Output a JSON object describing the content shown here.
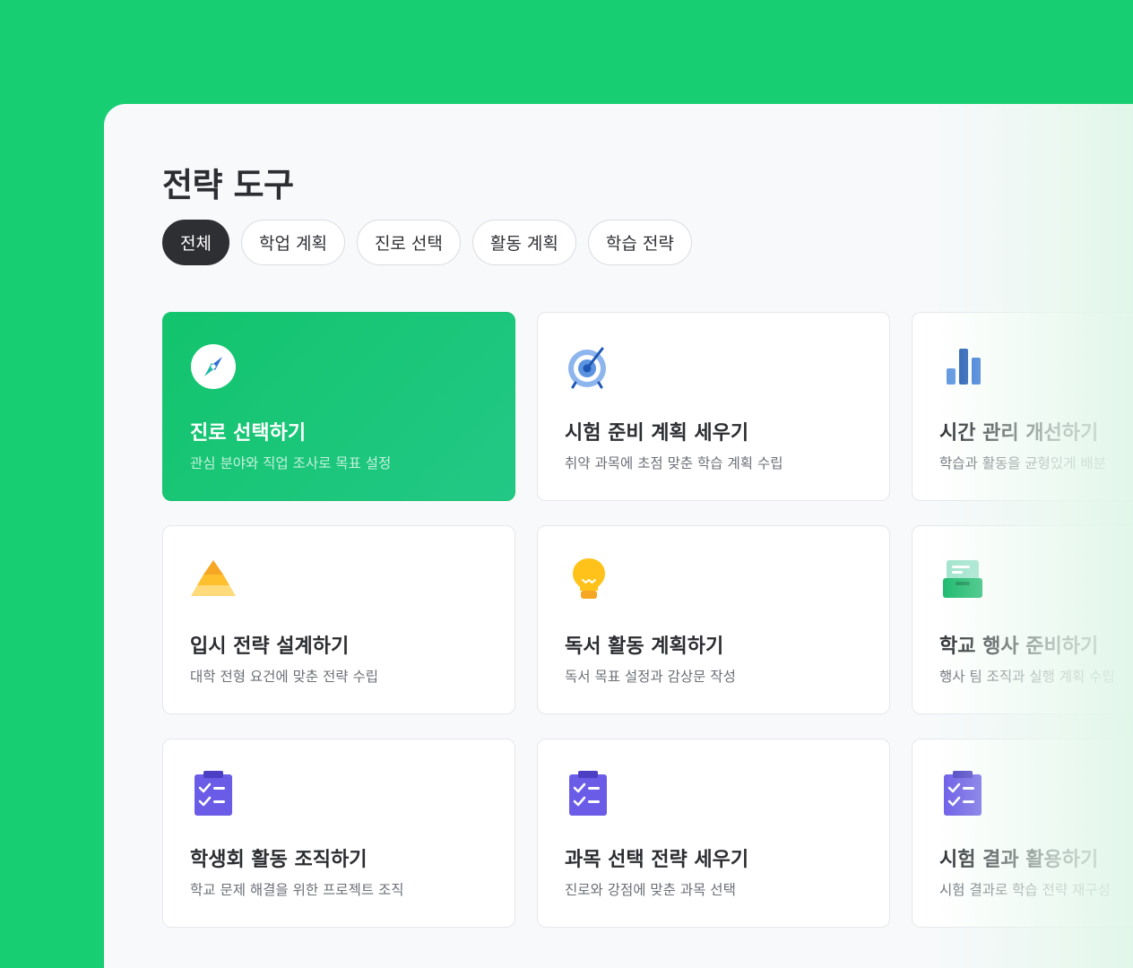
{
  "page": {
    "title": "전략 도구"
  },
  "filters": [
    {
      "label": "전체",
      "active": true
    },
    {
      "label": "학업 계획",
      "active": false
    },
    {
      "label": "진로 선택",
      "active": false
    },
    {
      "label": "활동 계획",
      "active": false
    },
    {
      "label": "학습 전략",
      "active": false
    }
  ],
  "cards": [
    {
      "title": "진로 선택하기",
      "description": "관심 분야와 직업 조사로 목표 설정",
      "icon": "compass-icon",
      "active": true
    },
    {
      "title": "시험 준비 계획 세우기",
      "description": "취약 과목에 초점 맞춘 학습 계획 수립",
      "icon": "target-icon",
      "active": false
    },
    {
      "title": "시간 관리 개선하기",
      "description": "학습과 활동을 균형있게 배분",
      "icon": "bar-chart-icon",
      "active": false
    },
    {
      "title": "입시 전략 설계하기",
      "description": "대학 전형 요건에 맞춘 전략 수립",
      "icon": "pyramid-icon",
      "active": false
    },
    {
      "title": "독서 활동 계획하기",
      "description": "독서 목표 설정과 감상문 작성",
      "icon": "lightbulb-icon",
      "active": false
    },
    {
      "title": "학교 행사 준비하기",
      "description": "행사 팀 조직과 실행 계획 수립",
      "icon": "inbox-tray-icon",
      "active": false
    },
    {
      "title": "학생회 활동 조직하기",
      "description": "학교 문제 해결을 위한 프로젝트 조직",
      "icon": "clipboard-checklist-icon",
      "active": false
    },
    {
      "title": "과목 선택 전략 세우기",
      "description": "진로와 강점에 맞춘 과목 선택",
      "icon": "clipboard-checklist-icon",
      "active": false
    },
    {
      "title": "시험 결과 활용하기",
      "description": "시험 결과로 학습 전략 재구성",
      "icon": "clipboard-checklist-icon",
      "active": false
    }
  ],
  "colors": {
    "brand_green": "#18CE73",
    "chip_active": "#2D2F33",
    "clipboard_purple": "#6B5CE7",
    "target_blue": "#2F6FD6",
    "pyramid_yellow": "#FFC02E"
  }
}
